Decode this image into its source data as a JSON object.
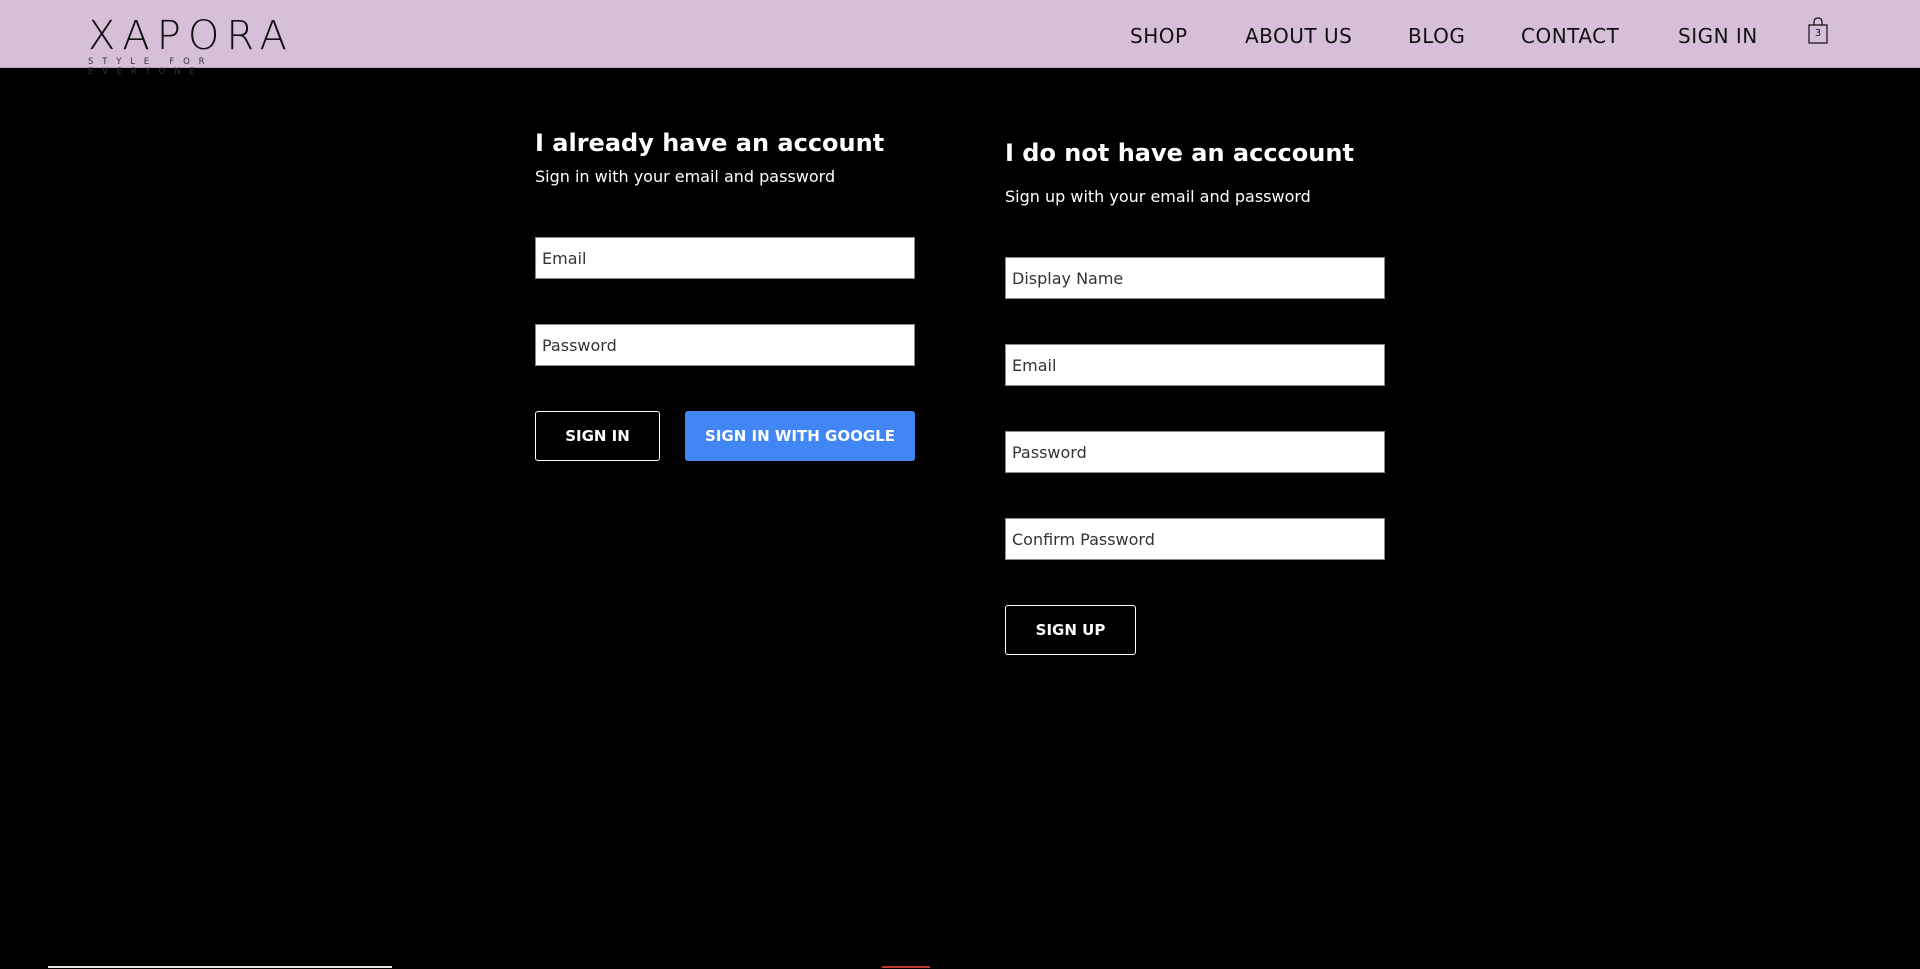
{
  "header": {
    "logo": {
      "name": "XAPORA",
      "tagline": "STYLE FOR EVERYONE"
    },
    "nav": [
      {
        "label": "SHOP"
      },
      {
        "label": "ABOUT US"
      },
      {
        "label": "BLOG"
      },
      {
        "label": "CONTACT"
      },
      {
        "label": "SIGN IN"
      }
    ],
    "cart": {
      "icon": "shopping-bag-icon",
      "count": "3"
    }
  },
  "signin": {
    "title": "I already have an account",
    "subtitle": "Sign in with your email and password",
    "email_placeholder": "Email",
    "password_placeholder": "Password",
    "signin_label": "SIGN IN",
    "google_label": "SIGN IN WITH GOOGLE"
  },
  "signup": {
    "title": "I do not have an acccount",
    "subtitle": "Sign up with your email and password",
    "name_placeholder": "Display Name",
    "email_placeholder": "Email",
    "password_placeholder": "Password",
    "confirm_placeholder": "Confirm Password",
    "signup_label": "SIGN UP"
  },
  "colors": {
    "header_bg": "#d7bfd9",
    "page_bg": "#000000",
    "google_blue": "#4285f4"
  }
}
